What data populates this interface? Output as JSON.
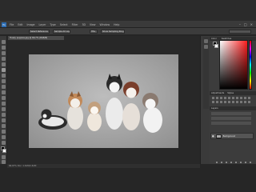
{
  "menu": {
    "items": [
      "File",
      "Edit",
      "Image",
      "Layer",
      "Type",
      "Select",
      "Filter",
      "3D",
      "View",
      "Window",
      "Help"
    ]
  },
  "options": {
    "sample_size": "Select Reference Point",
    "sample_all": "Sample All Layers",
    "ring": "HSL",
    "mode": "Show Sampling Ring"
  },
  "document": {
    "tab_title": "Husky puppies.jpg @ 66.7% (RGB/8)",
    "status": "66.67%   Doc: 1.61M/1.61M"
  },
  "panels": {
    "color_tab": "Color",
    "swatches_tab": "Swatches",
    "adjust_tab": "Adjustments",
    "styles_tab": "Styles",
    "layers_tab": "Layers",
    "layer_name": "Background"
  },
  "colors": {
    "picker_hue": "#ff1e1e",
    "foreground": "#000000",
    "background": "#ffffff",
    "accent": "#2d8ceb"
  }
}
